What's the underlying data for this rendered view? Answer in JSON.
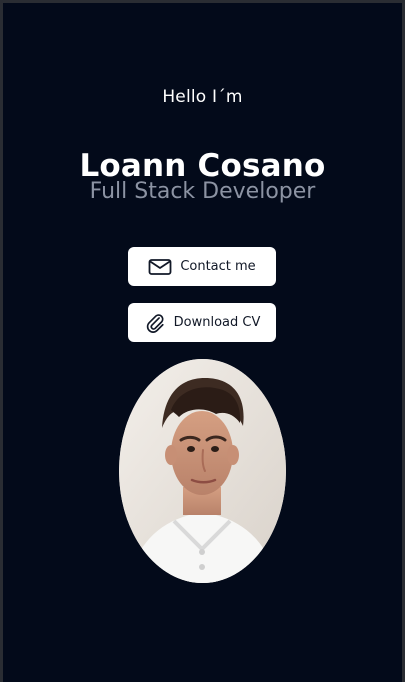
{
  "hero": {
    "greeting": "Hello I´m",
    "name": "Loann Cosano",
    "role": "Full Stack Developer"
  },
  "actions": {
    "contact_label": "Contact me",
    "cv_label": "Download CV"
  },
  "theme": {
    "background": "#030a1a",
    "text": "#ffffff",
    "muted": "#8c93a3",
    "button_bg": "#ffffff",
    "button_text": "#111827"
  },
  "icons": {
    "contact": "envelope-icon",
    "cv": "paperclip-icon"
  }
}
